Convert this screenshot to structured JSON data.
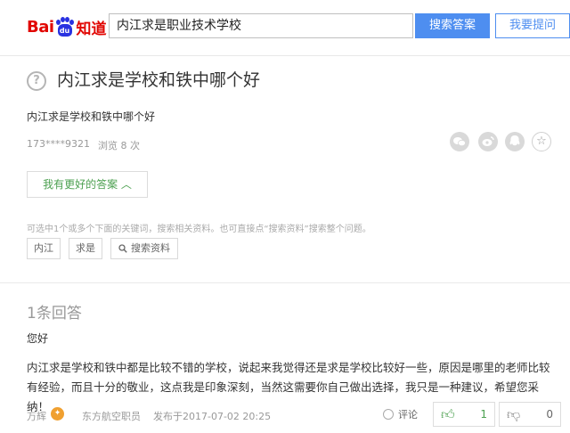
{
  "header": {
    "logo_bai": "Bai",
    "logo_du": "du",
    "logo_zhidao": "知道",
    "search_value": "内江求是职业技术学校",
    "search_button": "搜索答案",
    "ask_button": "我要提问"
  },
  "question": {
    "icon": "?",
    "title": "内江求是学校和铁中哪个好",
    "body": "内江求是学校和铁中哪个好",
    "user": "173****9321",
    "views": "浏览 8 次",
    "share_icons": [
      "wechat-icon",
      "weibo-icon",
      "qzone-icon",
      "star-icon"
    ],
    "better_answer_button": "我有更好的答案 ︿",
    "hint": "可选中1个或多个下面的关键词，搜索相关资料。也可直接点“搜索资料”搜索整个问题。",
    "keywords": [
      "内江",
      "求是"
    ],
    "search_material": "搜索资料"
  },
  "answer": {
    "count": "1条回答",
    "greeting": "您好",
    "body": "内江求是学校和铁中都是比较不错的学校，说起来我觉得还是求是学校比较好一些，原因是哪里的老师比较有经验，而且十分的敬业，这点我是印象深刻，当然这需要你自己做出选择，我只是一种建议，希望您采纳！",
    "user": "万辉",
    "user_title": "东方航空职员",
    "date": "发布于2017-07-02 20:25",
    "comment_label": "评论",
    "upvotes": "1",
    "downvotes": "0"
  },
  "colors": {
    "brand_red": "#e10602",
    "brand_blue": "#2932e1",
    "accent_blue": "#4e8ef0",
    "green": "#4ca050"
  }
}
